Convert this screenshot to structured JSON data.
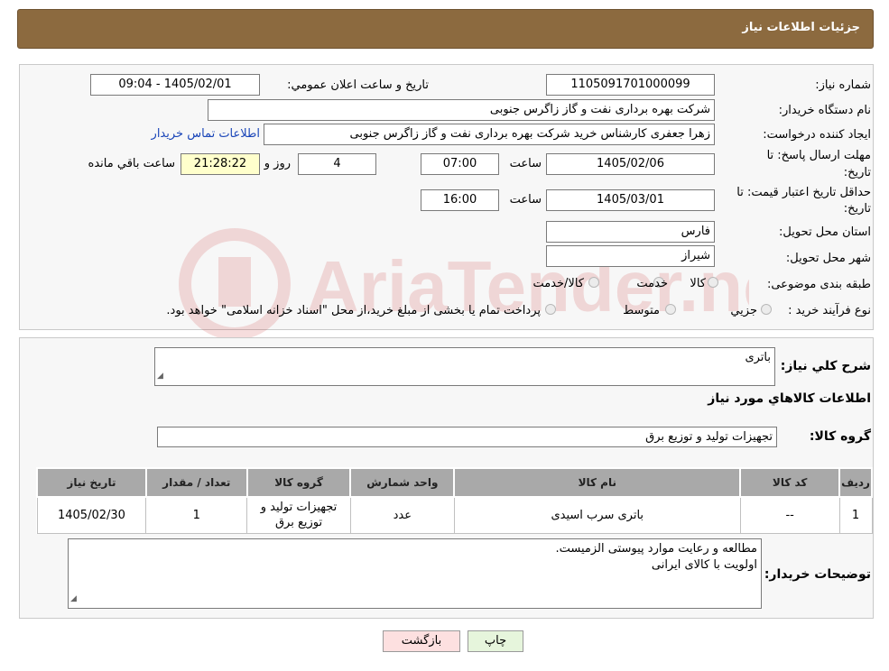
{
  "header": {
    "title": "جزئیات اطلاعات نیاز"
  },
  "form": {
    "need_number_label": "شماره نیاز:",
    "need_number": "1105091701000099",
    "announce_label": "تاریخ و ساعت اعلان عمومي:",
    "announce_value": "1405/02/01 - 09:04",
    "buyer_org_label": "نام دستگاه خريدار:",
    "buyer_org": "شرکت بهره برداری نفت و گاز زاگرس جنوبی",
    "creator_label": "ايجاد کننده درخواست:",
    "creator": "زهرا جعفری کارشناس خرید شرکت بهره برداری نفت و گاز زاگرس جنوبی",
    "contact_link": "اطلاعات تماس خريدار",
    "deadline_label_1": "مهلت ارسال پاسخ: تا",
    "deadline_label_2": "تاريخ:",
    "deadline_date": "1405/02/06",
    "time_label": "ساعت",
    "deadline_time": "07:00",
    "days_value": "4",
    "days_label": "روز و",
    "remaining_time": "21:28:22",
    "remaining_label": "ساعت باقي مانده",
    "validity_label_1": "حداقل تاريخ اعتبار قيمت: تا",
    "validity_label_2": "تاريخ:",
    "validity_date": "1405/03/01",
    "validity_time": "16:00",
    "province_label": "استان محل تحويل:",
    "province": "فارس",
    "city_label": "شهر محل تحويل:",
    "city": "شیراز",
    "category_label": "طبقه بندی موضوعی:",
    "category_options": [
      "کالا",
      "خدمت",
      "کالا/خدمت"
    ],
    "process_label": "نوع فرآيند خريد :",
    "process_options": [
      "جزيي",
      "متوسط"
    ],
    "process_note": "پرداخت تمام يا بخشی از مبلغ خريد،از محل \"اسناد خزانه اسلامی\" خواهد بود."
  },
  "details": {
    "summary_label": "شرح کلي نياز:",
    "summary": "باتری",
    "goods_info_title": "اطلاعات کالاهاي مورد نياز",
    "goods_group_label": "گروه کالا:",
    "goods_group": "تجهیزات تولید و توزیع برق"
  },
  "table": {
    "headers": [
      "رديف",
      "کد کالا",
      "نام کالا",
      "واحد شمارش",
      "گروه کالا",
      "تعداد / مقدار",
      "تاريخ نياز"
    ],
    "rows": [
      [
        "1",
        "--",
        "باتری سرب اسیدی",
        "عدد",
        "تجهیزات تولید و توزیع برق",
        "1",
        "1405/02/30"
      ]
    ]
  },
  "buyer_notes": {
    "label": "توضيحات خريدار:",
    "line1": "مطالعه و رعایت موارد پیوستی الزمیست.",
    "line2": "اولویت با کالای ایرانی"
  },
  "buttons": {
    "print": "چاپ",
    "back": "بازگشت"
  },
  "colors": {
    "header_bg": "#8c6a3f",
    "table_header_bg": "#a9a9a9",
    "remaining_bg": "#ffffcc",
    "back_btn_bg": "#fde0e0",
    "print_btn_bg": "#e6f5dc"
  },
  "watermark": {
    "text": "AriaTender.neT"
  }
}
